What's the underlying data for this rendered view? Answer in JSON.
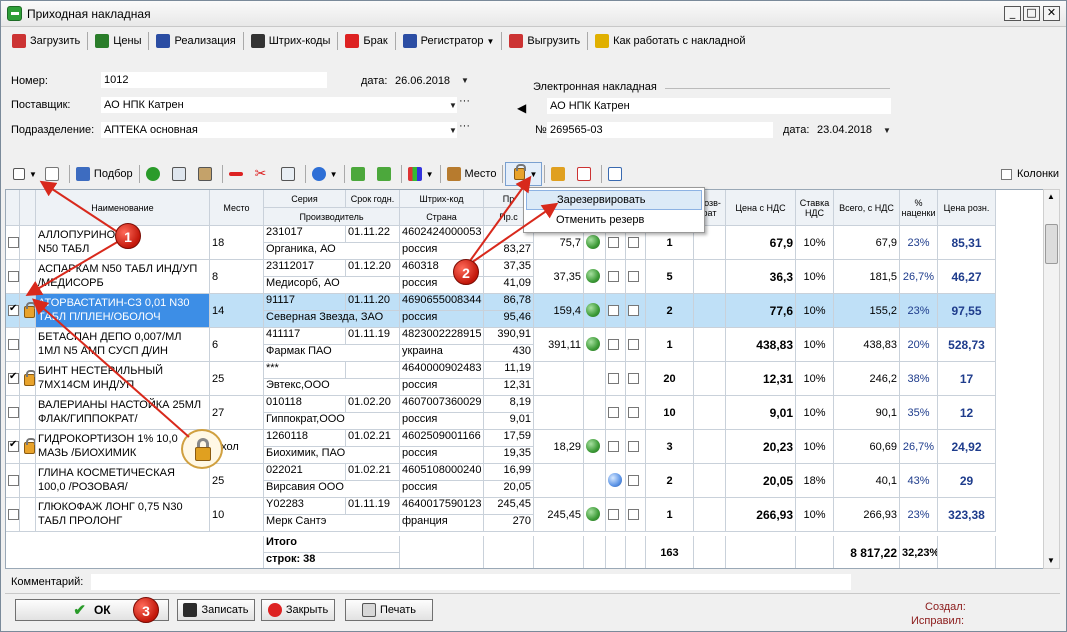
{
  "window": {
    "title": "Приходная накладная",
    "min": "_",
    "max": "□",
    "close": "✕"
  },
  "toolbar1": [
    {
      "name": "load-button",
      "label": "Загрузить",
      "icon": "load-icon",
      "color": "#c33"
    },
    {
      "name": "prices-button",
      "label": "Цены",
      "icon": "prices-icon",
      "color": "#2a7d2a"
    },
    {
      "name": "sale-button",
      "label": "Реализация",
      "icon": "sale-icon",
      "color": "#2b4da3"
    },
    {
      "name": "barcodes-button",
      "label": "Штрих-коды",
      "icon": "barcode-icon",
      "color": "#333"
    },
    {
      "name": "defect-button",
      "label": "Брак",
      "icon": "defect-icon",
      "color": "#d22"
    },
    {
      "name": "registrar-button",
      "label": "Регистратор",
      "icon": "registrar-icon",
      "color": "#2b4da3"
    },
    {
      "name": "upload-button",
      "label": "Выгрузить",
      "icon": "upload-icon",
      "color": "#c33"
    },
    {
      "name": "help-button",
      "label": "Как работать с накладной",
      "icon": "help-icon",
      "color": "#e0b000"
    }
  ],
  "form": {
    "number_label": "Номер:",
    "number": "1012",
    "date_label": "дата:",
    "date": "26.06.2018",
    "supplier_label": "Поставщик:",
    "supplier": "АО НПК Катрен",
    "dept_label": "Подразделение:",
    "dept": "АПТЕКА основная",
    "einvoice_label": "Электронная накладная",
    "einvoice_supplier": "АО НПК Катрен",
    "no_label": "№",
    "no": "269565-03",
    "edate_label": "дата:",
    "edate": "23.04.2018"
  },
  "toolbar2": {
    "pick": "Подбор",
    "place": "Место",
    "columns": "Колонки"
  },
  "popup": {
    "reserve": "Зарезервировать",
    "cancel": "Отменить резерв"
  },
  "headers": {
    "name": "Наименование",
    "place": "Место",
    "series": "Серия",
    "expiry": "Срок годн.",
    "barcode": "Штрих-код",
    "producer": "Производитель",
    "country": "Страна",
    "pr": "Пр",
    "prs": "Пр.с",
    "ret": "Возв-рат",
    "price_vat": "Цена с НДС",
    "vat": "Ставка НДС",
    "total_vat": "Всего, с НДС",
    "markup": "% наценки",
    "retail": "Цена розн."
  },
  "rows": [
    {
      "chk": false,
      "lock": false,
      "name1": "АЛЛОПУРИНОЛ",
      "name2": "N50 ТАБЛ",
      "place": "18",
      "series": "231017",
      "exp": "01.11.22",
      "barcode": "4602424000053",
      "pr1": "",
      "pr2": "83,27",
      "producer": "Органика, АО",
      "country": "россия",
      "c1": "75,7",
      "green": true,
      "blue": false,
      "qty": "1",
      "price": "67,9",
      "vat": "10%",
      "total": "67,9",
      "mk": "23%",
      "retail": "85,31"
    },
    {
      "chk": false,
      "lock": false,
      "name1": "АСПАРКАМ N50 ТАБЛ ИНД/УП",
      "name2": "/МЕДИСОРБ",
      "place": "8",
      "series": "23112017",
      "exp": "01.12.20",
      "barcode": "460318",
      "pr1": "37,35",
      "pr2": "41,09",
      "producer": "Медисорб, АО",
      "country": "россия",
      "c1": "37,35",
      "green": true,
      "blue": false,
      "qty": "5",
      "price": "36,3",
      "vat": "10%",
      "total": "181,5",
      "mk": "26,7%",
      "retail": "46,27"
    },
    {
      "chk": true,
      "lock": true,
      "sel": true,
      "name1": "АТОРВАСТАТИН-СЗ  0,01 N30",
      "name2": "ТАБЛ П/ПЛЕН/ОБОЛОЧ",
      "place": "14",
      "series": "91117",
      "exp": "01.11.20",
      "barcode": "4690655008344",
      "pr1": "86,78",
      "pr2": "95,46",
      "producer": "Северная Звезда, ЗАО",
      "country": "россия",
      "c1": "159,4",
      "green": true,
      "blue": false,
      "qty": "2",
      "price": "77,6",
      "vat": "10%",
      "total": "155,2",
      "mk": "23%",
      "retail": "97,55"
    },
    {
      "chk": false,
      "lock": false,
      "name1": "БЕТАСПАН ДЕПО 0,007/МЛ",
      "name2": "1МЛ N5 АМП СУСП Д/ИН",
      "place": "6",
      "series": "411117",
      "exp": "01.11.19",
      "barcode": "4823002228915",
      "pr1": "390,91",
      "pr2": "430",
      "producer": "Фармак ПАО",
      "country": "украина",
      "c1": "391,11",
      "green": true,
      "blue": false,
      "qty": "1",
      "price": "438,83",
      "vat": "10%",
      "total": "438,83",
      "mk": "20%",
      "retail": "528,73"
    },
    {
      "chk": true,
      "lock": true,
      "name1": "БИНТ НЕСТЕРИЛЬНЫЙ",
      "name2": "7МХ14СМ ИНД/УП",
      "place": "25",
      "series": "***",
      "exp": "",
      "barcode": "4640000902483",
      "pr1": "11,19",
      "pr2": "12,31",
      "producer": "Эвтекс,ООО",
      "country": "россия",
      "c1": "",
      "green": false,
      "blue": false,
      "qty": "20",
      "price": "12,31",
      "vat": "10%",
      "total": "246,2",
      "mk": "38%",
      "retail": "17"
    },
    {
      "chk": false,
      "lock": false,
      "name1": "ВАЛЕРИАНЫ НАСТОЙКА 25МЛ",
      "name2": "ФЛАК/ГИППОКРАТ/",
      "place": "27",
      "series": "010118",
      "exp": "01.02.20",
      "barcode": "4607007360029",
      "pr1": "8,19",
      "pr2": "9,01",
      "producer": "Гиппократ,ООО",
      "country": "россия",
      "c1": "",
      "green": false,
      "blue": false,
      "qty": "10",
      "price": "9,01",
      "vat": "10%",
      "total": "90,1",
      "mk": "35%",
      "retail": "12"
    },
    {
      "chk": true,
      "lock": true,
      "name1": "ГИДРОКОРТИЗОН 1% 10,0",
      "name2": "МАЗЬ /БИОХИМИК",
      "place": "1 хол",
      "series": "1260118",
      "exp": "01.02.21",
      "barcode": "4602509001166",
      "pr1": "17,59",
      "pr2": "19,35",
      "producer": "Биохимик, ПАО",
      "country": "россия",
      "c1": "18,29",
      "green": true,
      "blue": false,
      "qty": "3",
      "price": "20,23",
      "vat": "10%",
      "total": "60,69",
      "mk": "26,7%",
      "retail": "24,92"
    },
    {
      "chk": false,
      "lock": false,
      "name1": "ГЛИНА КОСМЕТИЧЕСКАЯ",
      "name2": "100,0 /РОЗОВАЯ/",
      "place": "25",
      "series": "022021",
      "exp": "01.02.21",
      "barcode": "4605108000240",
      "pr1": "16,99",
      "pr2": "20,05",
      "producer": "Вирсавия ООО",
      "country": "россия",
      "c1": "",
      "green": false,
      "blue": true,
      "qty": "2",
      "price": "20,05",
      "vat": "18%",
      "total": "40,1",
      "mk": "43%",
      "retail": "29"
    },
    {
      "chk": false,
      "lock": false,
      "name1": "ГЛЮКОФАЖ ЛОНГ 0,75 N30",
      "name2": "ТАБЛ ПРОЛОНГ",
      "place": "10",
      "series": "Y02283",
      "exp": "01.11.19",
      "barcode": "4640017590123",
      "pr1": "245,45",
      "pr2": "270",
      "producer": "Мерк Сантэ",
      "country": "франция",
      "c1": "245,45",
      "green": true,
      "blue": false,
      "qty": "1",
      "price": "266,93",
      "vat": "10%",
      "total": "266,93",
      "mk": "23%",
      "retail": "323,38"
    }
  ],
  "totals": {
    "label": "Итого",
    "rows_label": "строк:  38",
    "qty": "163",
    "total": "8 817,22",
    "markup": "32,23%"
  },
  "bottom": {
    "comment_label": "Комментарий:",
    "ok": "ОК",
    "save": "Записать",
    "close": "Закрыть",
    "print": "Печать",
    "created": "Создал:",
    "edited": "Исправил:"
  },
  "badges": [
    "1",
    "2",
    "3"
  ],
  "colors": {
    "badge": "#c2170a",
    "selected_row": "#bfe0f7",
    "blue_text": "#1e3c8c"
  }
}
